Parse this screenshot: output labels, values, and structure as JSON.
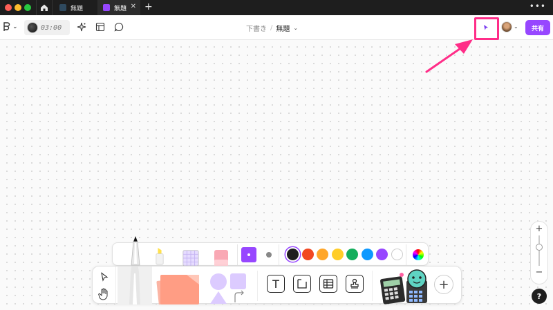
{
  "titlebar": {
    "tabs": [
      {
        "label": "無題"
      },
      {
        "label": "無題",
        "active": true
      }
    ],
    "close_glyph": "✕",
    "new_tab_glyph": "+",
    "more_glyph": "•••"
  },
  "toolbar": {
    "menu_chevron": "⌄",
    "timer_text": "03:00",
    "breadcrumb": {
      "draft": "下書き",
      "separator": "/",
      "file": "無題",
      "chevron": "⌄"
    },
    "share_label": "共有"
  },
  "palette": {
    "colors": [
      "#1e1e1e",
      "#f24822",
      "#ffa629",
      "#ffcd29",
      "#14ae5c",
      "#0d99ff",
      "#9747ff",
      "#ffffff"
    ],
    "selected_color_index": 0
  },
  "zoom": {
    "plus": "+",
    "minus": "−"
  },
  "help_label": "?",
  "dock": {
    "text_glyph": "T",
    "add_glyph": "+"
  },
  "colors": {
    "accent": "#9747ff",
    "highlight": "#ff2d88"
  }
}
